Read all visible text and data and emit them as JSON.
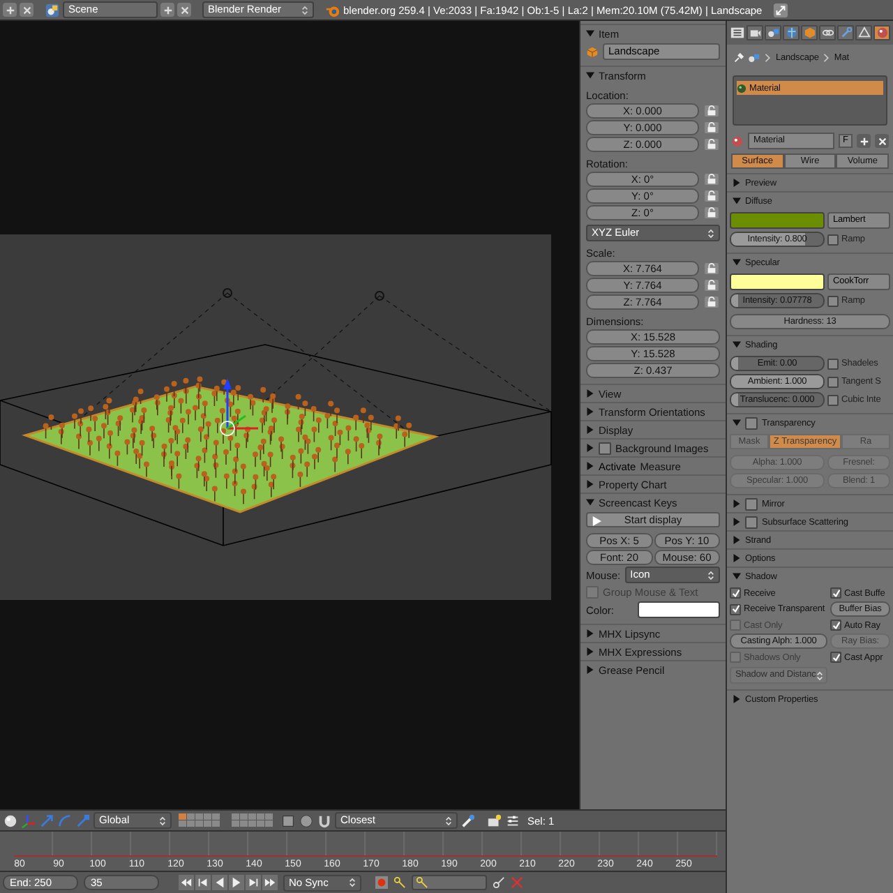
{
  "top_bar": {
    "scene": "Scene",
    "render_engine": "Blender Render",
    "stats": "blender.org 259.4 | Ve:2033 | Fa:1942 | Ob:1-5 | La:2 | Mem:20.10M (75.42M) | Landscape"
  },
  "n_panel": {
    "panels": [
      {
        "kind": "item",
        "title": "Item",
        "expanded": true,
        "object_name": "Landscape"
      },
      {
        "kind": "transform",
        "title": "Transform",
        "expanded": true,
        "groups": [
          {
            "label": "Location:",
            "lock": true,
            "fields": [
              "X: 0.000",
              "Y: 0.000",
              "Z: 0.000"
            ]
          },
          {
            "label": "Rotation:",
            "lock": true,
            "fields": [
              "X: 0°",
              "Y: 0°",
              "Z: 0°"
            ],
            "mode": "XYZ Euler"
          },
          {
            "label": "Scale:",
            "lock": true,
            "fields": [
              "X: 7.764",
              "Y: 7.764",
              "Z: 7.764"
            ]
          },
          {
            "label": "Dimensions:",
            "lock": false,
            "fields": [
              "X: 15.528",
              "Y: 15.528",
              "Z: 0.437"
            ]
          }
        ]
      },
      {
        "kind": "plain",
        "title": "View",
        "expanded": false
      },
      {
        "kind": "plain",
        "title": "Transform Orientations",
        "expanded": false
      },
      {
        "kind": "plain",
        "title": "Display",
        "expanded": false
      },
      {
        "kind": "check",
        "title": "Background Images",
        "expanded": false,
        "checked": false
      },
      {
        "kind": "measure",
        "title": "Measure",
        "expanded": false,
        "button": "Activate"
      },
      {
        "kind": "plain",
        "title": "Property Chart",
        "expanded": false
      },
      {
        "kind": "screencast",
        "title": "Screencast Keys",
        "expanded": true,
        "start_button": "Start display",
        "fields": [
          "Pos X: 5",
          "Pos Y: 10",
          "Font: 20",
          "Mouse: 60"
        ],
        "mouse_label": "Mouse:",
        "mouse_value": "Icon",
        "group_option": {
          "label": "Group Mouse & Text",
          "checked": false,
          "disabled": true
        },
        "color_label": "Color:",
        "color": "#ffffff"
      },
      {
        "kind": "plain",
        "title": "MHX Lipsync",
        "expanded": false
      },
      {
        "kind": "plain",
        "title": "MHX Expressions",
        "expanded": false
      },
      {
        "kind": "plain",
        "title": "Grease Pencil",
        "expanded": false
      }
    ]
  },
  "properties": {
    "context_tabs": [
      {
        "kind": "render",
        "selected": false
      },
      {
        "kind": "scene",
        "selected": false
      },
      {
        "kind": "world",
        "selected": false
      },
      {
        "kind": "object",
        "selected": false
      },
      {
        "kind": "constraints",
        "selected": false
      },
      {
        "kind": "modifiers",
        "selected": false
      },
      {
        "kind": "data",
        "selected": false
      },
      {
        "kind": "material",
        "selected": true
      }
    ],
    "breadcrumb": [
      "Landscape",
      "Mat"
    ],
    "material_slots": [
      {
        "name": "Material",
        "selected": true
      }
    ],
    "material_field": "Material",
    "fake_user": "F",
    "type_tabs": [
      {
        "label": "Surface",
        "selected": true
      },
      {
        "label": "Wire",
        "selected": false
      },
      {
        "label": "Volume",
        "selected": false
      }
    ],
    "panels": [
      {
        "kind": "plain",
        "title": "Preview",
        "expanded": false
      },
      {
        "kind": "color",
        "title": "Diffuse",
        "expanded": true,
        "color": "#6b8e00",
        "shader": "Lambert",
        "intensity": {
          "text": "Intensity: 0.800",
          "level": 0.8
        },
        "ramp": {
          "label": "Ramp",
          "checked": false
        }
      },
      {
        "kind": "color",
        "title": "Specular",
        "expanded": true,
        "color": "#ffff99",
        "shader": "CookTorr",
        "intensity": {
          "text": "Intensity: 0.07778",
          "level": 0.08
        },
        "ramp": {
          "label": "Ramp",
          "checked": false
        },
        "hardness": "Hardness: 13"
      },
      {
        "kind": "shading",
        "title": "Shading",
        "expanded": true,
        "rows": [
          {
            "slider": {
              "text": "Emit: 0.00",
              "level": 0
            },
            "option": {
              "label": "Shadeles",
              "checked": false
            }
          },
          {
            "slider": {
              "text": "Ambient: 1.000",
              "level": 1
            },
            "option": {
              "label": "Tangent S",
              "checked": false
            }
          },
          {
            "slider": {
              "text": "Translucenc: 0.000",
              "level": 0
            },
            "option": {
              "label": "Cubic Inte",
              "checked": false
            }
          }
        ]
      },
      {
        "kind": "transparency",
        "title": "Transparency",
        "expanded": true,
        "checked": false,
        "modes": [
          {
            "label": "Mask",
            "selected": false
          },
          {
            "label": "Z Transparency",
            "selected": true
          },
          {
            "label": "Ra",
            "selected": false
          }
        ],
        "disabled": true,
        "fields": [
          "Alpha: 1.000",
          "Fresnel:",
          "Specular: 1.000",
          "Blend: 1"
        ]
      },
      {
        "kind": "check",
        "title": "Mirror",
        "expanded": false,
        "checked": false
      },
      {
        "kind": "check",
        "title": "Subsurface Scattering",
        "expanded": false,
        "checked": false
      },
      {
        "kind": "plain",
        "title": "Strand",
        "expanded": false
      },
      {
        "kind": "plain",
        "title": "Options",
        "expanded": false
      },
      {
        "kind": "shadow",
        "title": "Shadow",
        "expanded": true,
        "items": [
          {
            "kind": "check",
            "label": "Receive",
            "checked": true,
            "disabled": false
          },
          {
            "kind": "check",
            "label": "Cast Buffe",
            "checked": true,
            "disabled": false
          },
          {
            "kind": "check",
            "label": "Receive Transparent",
            "checked": true,
            "disabled": false
          },
          {
            "kind": "field",
            "text": "Buffer Bias",
            "disabled": false
          },
          {
            "kind": "check",
            "label": "Cast Only",
            "checked": false,
            "disabled": true
          },
          {
            "kind": "check",
            "label": "Auto Ray",
            "checked": true,
            "disabled": false
          },
          {
            "kind": "field",
            "text": "Casting Alph: 1.000",
            "disabled": false
          },
          {
            "kind": "field",
            "text": "Ray Bias:",
            "disabled": true
          },
          {
            "kind": "check",
            "label": "Shadows Only",
            "checked": false,
            "disabled": true
          },
          {
            "kind": "check",
            "label": "Cast Appr",
            "checked": true,
            "disabled": false
          },
          {
            "kind": "dropdown",
            "text": "Shadow and Distanc",
            "disabled": true
          }
        ]
      },
      {
        "kind": "plain",
        "title": "Custom Properties",
        "expanded": false
      }
    ]
  },
  "viewport_header": {
    "orientation": "Global",
    "snap_target": "Closest",
    "selection": "Sel: 1"
  },
  "timeline": {
    "ticks": [
      "80",
      "90",
      "100",
      "110",
      "120",
      "130",
      "140",
      "150",
      "160",
      "170",
      "180",
      "190",
      "200",
      "210",
      "220",
      "230",
      "240",
      "250"
    ],
    "end": "End: 250",
    "current_frame": "35",
    "sync": "No Sync"
  }
}
